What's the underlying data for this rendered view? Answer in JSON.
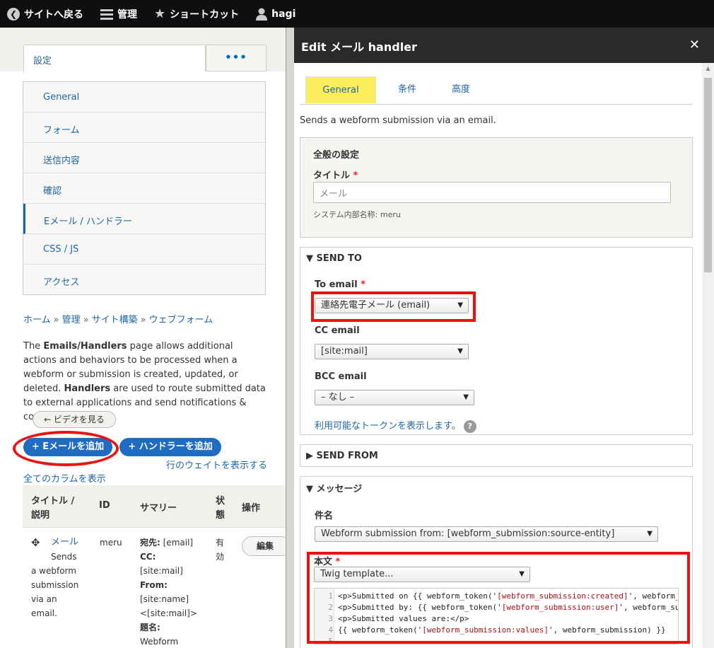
{
  "toolbar": {
    "back": "サイトへ戻る",
    "manage": "管理",
    "shortcuts": "ショートカット",
    "user": "hagi"
  },
  "left": {
    "tab_settings": "設定",
    "tab_more": "•••",
    "nav": [
      "General",
      "フォーム",
      "送信内容",
      "確認",
      "Eメール / ハンドラー",
      "CSS / JS",
      "アクセス"
    ],
    "breadcrumb": [
      "ホーム",
      "管理",
      "サイト構築",
      "ウェブフォーム"
    ],
    "breadcrumb_sep": "»",
    "desc_1": "The ",
    "desc_bold_1": "Emails/Handlers",
    "desc_2": " page allows additional actions and behaviors to be processed when a webform or submission is created, updated, or deleted. ",
    "desc_bold_2": "Handlers",
    "desc_3": " are used to route submitted data to external applications and send notifications & confirmations.",
    "video_button": "← ビデオを見る",
    "add_email_button": "+ Eメールを追加",
    "add_handler_button": "+ ハンドラーを追加",
    "show_weights": "行のウェイトを表示する",
    "show_all_columns": "全てのカラムを表示",
    "table_headers": {
      "title": "タイトル /",
      "title2": "説明",
      "id": "ID",
      "summary": "サマリー",
      "status": "状",
      "status2": "態",
      "ops": "操作"
    },
    "row": {
      "drag": "✥",
      "title_link": "メール",
      "desc_lines": [
        "Sends",
        "a webform",
        "submission",
        "via an",
        "email."
      ],
      "id": "meru",
      "summary": [
        {
          "b": "宛先:",
          "t": " [email]"
        },
        {
          "b": "CC:",
          "t": ""
        },
        {
          "b": "",
          "t": "[site:mail]"
        },
        {
          "b": "From:",
          "t": ""
        },
        {
          "b": "",
          "t": "[site:name]"
        },
        {
          "b": "",
          "t": "<[site:mail]>"
        },
        {
          "b": "題名:",
          "t": ""
        },
        {
          "b": "",
          "t": "Webform"
        }
      ],
      "status": [
        "有",
        "効"
      ],
      "edit_button": "編集"
    }
  },
  "dialog": {
    "title": "Edit メール handler",
    "close": "✕",
    "tabs": [
      "General",
      "条件",
      "高度"
    ],
    "description": "Sends a webform submission via an email.",
    "general": {
      "legend": "全般の設定",
      "title_label": "タイトル",
      "title_placeholder": "メール",
      "machine_name": "システム内部名称: meru"
    },
    "send_to": {
      "legend": "SEND TO",
      "to_label": "To email",
      "to_value": "連絡先電子メール (email)",
      "cc_label": "CC email",
      "cc_value": "[site:mail]",
      "bcc_label": "BCC email",
      "bcc_value": "– なし –",
      "tokens_link": "利用可能なトークンを表示します。",
      "help": "?"
    },
    "send_from": {
      "legend": "SEND FROM"
    },
    "message": {
      "legend": "メッセージ",
      "subject_label": "件名",
      "subject_value": "Webform submission from: [webform_submission:source-entity]",
      "body_label": "本文",
      "body_value": "Twig template...",
      "code_lines": [
        {
          "n": "1",
          "a": "<p>Submitted on {{ webform_token('",
          "s": "[webform_submission:created]",
          "b": "', webform_s"
        },
        {
          "n": "2",
          "a": "<p>Submitted by: {{ webform_token('",
          "s": "[webform_submission:user]",
          "b": "', webform_sub"
        },
        {
          "n": "3",
          "a": "<p>Submitted values are:</p>",
          "s": "",
          "b": ""
        },
        {
          "n": "4",
          "a": "{{ webform_token('",
          "s": "[webform_submission:values]",
          "b": "', webform_submission) }}"
        },
        {
          "n": "5",
          "a": "",
          "s": "",
          "b": ""
        }
      ]
    }
  },
  "colors": {
    "accent": "#1f66a5",
    "highlight": "#fbee5a",
    "annotation": "#e11111"
  }
}
